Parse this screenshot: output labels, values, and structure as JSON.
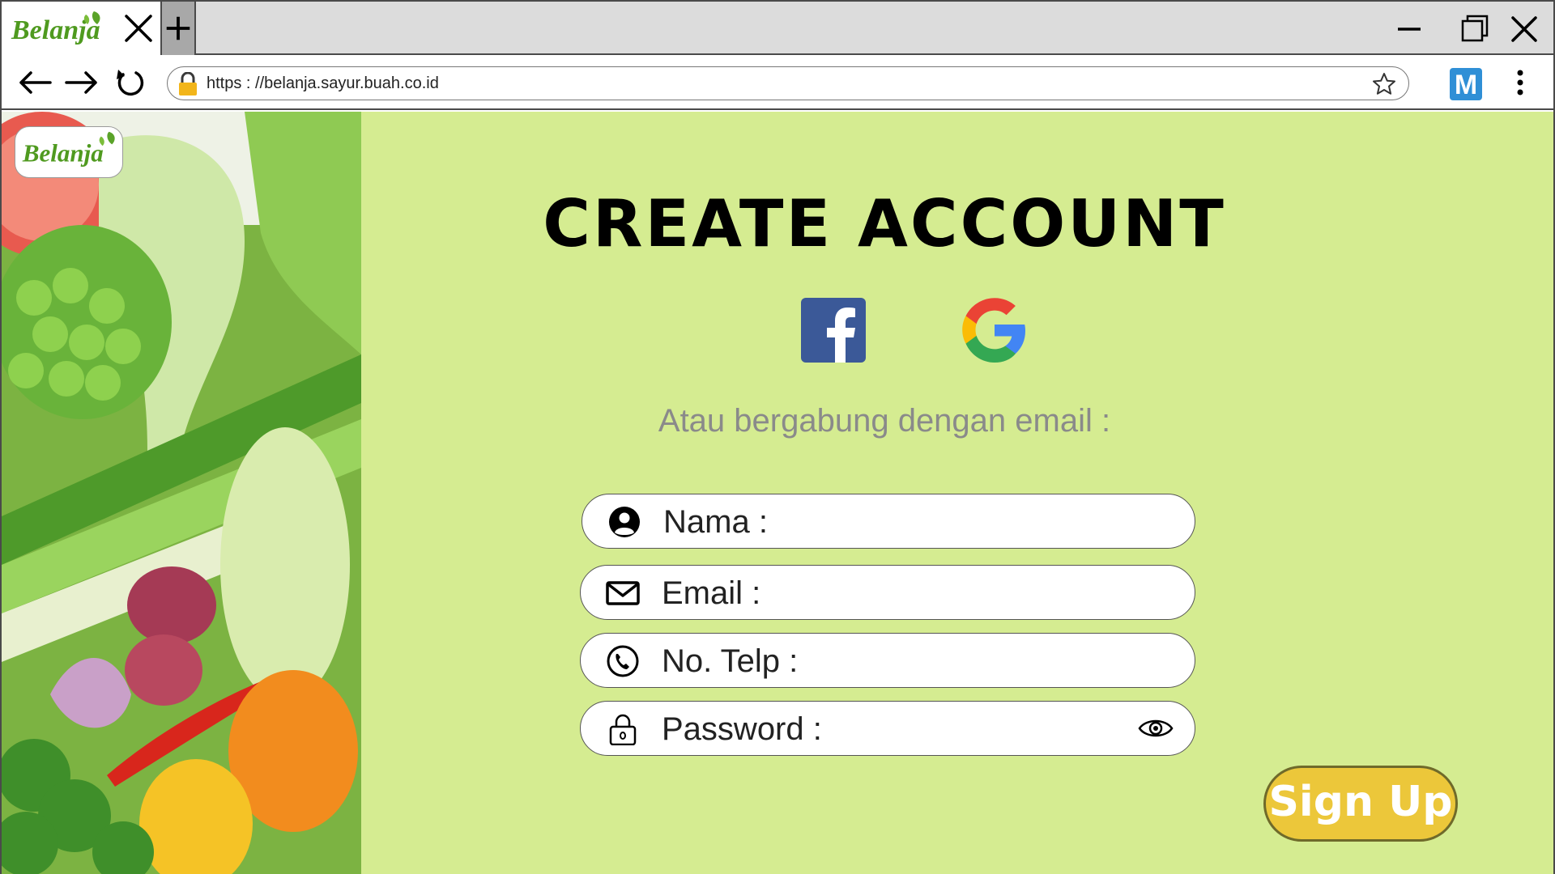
{
  "browser": {
    "tab": {
      "logo_text": "Belanja"
    },
    "url": "https : //belanja.sayur.buah.co.id",
    "extension_letter": "M"
  },
  "page": {
    "logo_text": "Belanja",
    "title": "CREATE ACCOUNT",
    "social": [
      {
        "icon": "facebook-icon"
      },
      {
        "icon": "google-icon"
      }
    ],
    "subtitle": "Atau bergabung dengan email :",
    "form": {
      "name_placeholder": "Nama :",
      "email_placeholder": "Email :",
      "phone_placeholder": "No. Telp :",
      "password_placeholder": "Password :"
    },
    "signup_label": "Sign Up"
  },
  "colors": {
    "page_background": "#d5ec91",
    "signup_button": "#ecc73a",
    "facebook_blue": "#3b5998"
  }
}
